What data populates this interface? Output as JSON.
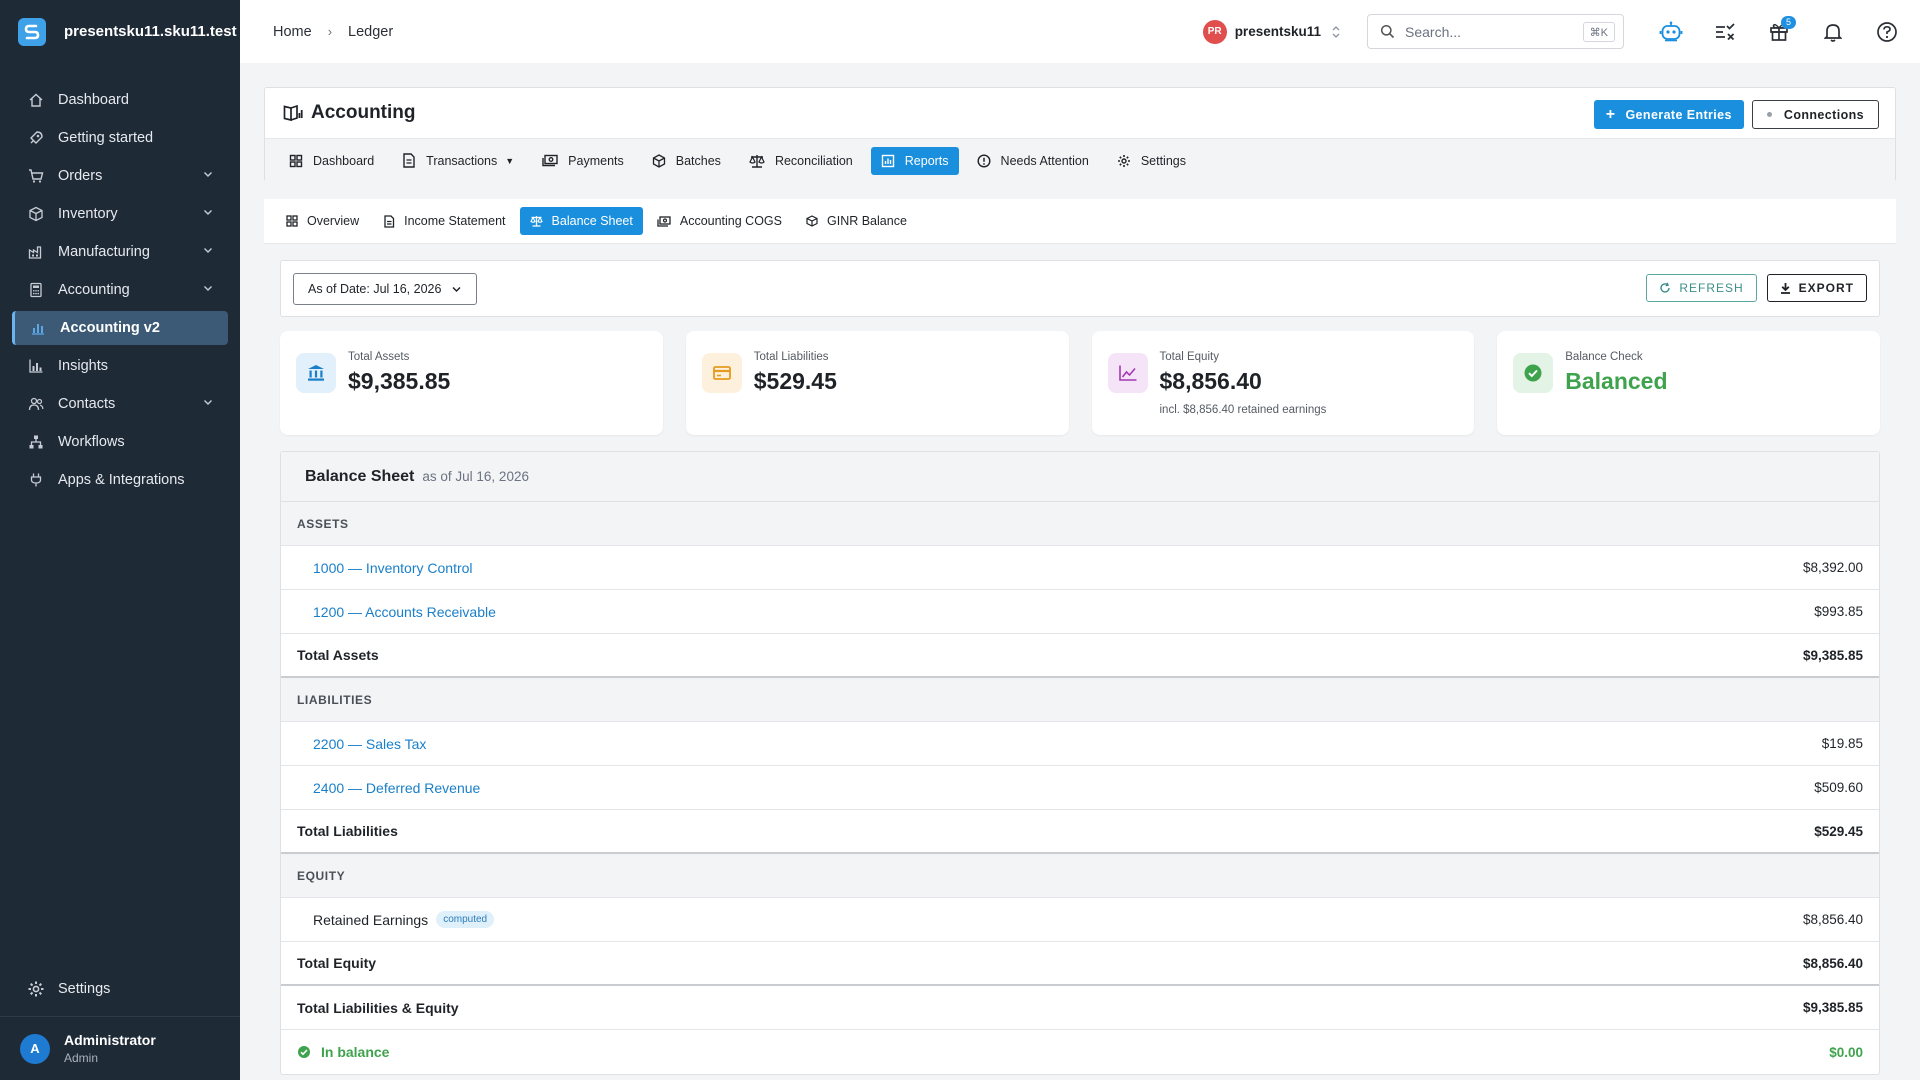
{
  "app": {
    "org_domain": "presentsku11.sku11.test",
    "brand_color": "#3fa2e9",
    "accent_color": "#1a8fde"
  },
  "sidebar": {
    "items": [
      {
        "label": "Dashboard",
        "icon": "home-icon",
        "expandable": false
      },
      {
        "label": "Getting started",
        "icon": "rocket-icon",
        "expandable": false
      },
      {
        "label": "Orders",
        "icon": "cart-icon",
        "expandable": true
      },
      {
        "label": "Inventory",
        "icon": "box-icon",
        "expandable": true
      },
      {
        "label": "Manufacturing",
        "icon": "factory-icon",
        "expandable": true
      },
      {
        "label": "Accounting",
        "icon": "calculator-icon",
        "expandable": true
      },
      {
        "label": "Accounting v2",
        "icon": "ledger-chart-icon",
        "expandable": false,
        "active": true
      },
      {
        "label": "Insights",
        "icon": "bar-chart-icon",
        "expandable": false
      },
      {
        "label": "Contacts",
        "icon": "people-icon",
        "expandable": true
      },
      {
        "label": "Workflows",
        "icon": "workflow-icon",
        "expandable": false
      },
      {
        "label": "Apps & Integrations",
        "icon": "plug-icon",
        "expandable": false
      }
    ],
    "settings_label": "Settings",
    "user": {
      "initial": "A",
      "name": "Administrator",
      "role": "Admin"
    }
  },
  "topbar": {
    "breadcrumb": [
      "Home",
      "Ledger"
    ],
    "org": {
      "initials": "PR",
      "name": "presentsku11"
    },
    "search": {
      "placeholder": "Search...",
      "shortcut": "⌘K"
    },
    "gift_count": "5"
  },
  "accounting": {
    "title": "Accounting",
    "generate_label": "Generate Entries",
    "connections_label": "Connections",
    "tabs": [
      {
        "label": "Dashboard",
        "icon": "grid-icon"
      },
      {
        "label": "Transactions",
        "icon": "document-icon",
        "dropdown": true
      },
      {
        "label": "Payments",
        "icon": "cash-icon"
      },
      {
        "label": "Batches",
        "icon": "cube-icon"
      },
      {
        "label": "Reconciliation",
        "icon": "scale-icon"
      },
      {
        "label": "Reports",
        "icon": "report-icon",
        "active": true
      },
      {
        "label": "Needs Attention",
        "icon": "alert-circle-icon"
      },
      {
        "label": "Settings",
        "icon": "gear-icon"
      }
    ]
  },
  "report_tabs": [
    {
      "label": "Overview",
      "icon": "grid-icon"
    },
    {
      "label": "Income Statement",
      "icon": "document-icon"
    },
    {
      "label": "Balance Sheet",
      "icon": "scale-icon",
      "active": true
    },
    {
      "label": "Accounting COGS",
      "icon": "cash-icon"
    },
    {
      "label": "GINR Balance",
      "icon": "cube-icon"
    }
  ],
  "toolbar": {
    "date_label": "As of Date:",
    "date_value": "Jul 16, 2026",
    "refresh_label": "REFRESH",
    "export_label": "EXPORT"
  },
  "kpis": [
    {
      "label": "Total Assets",
      "value": "$9,385.85",
      "icon": "bank-icon",
      "note": ""
    },
    {
      "label": "Total Liabilities",
      "value": "$529.45",
      "icon": "credit-card-icon",
      "note": ""
    },
    {
      "label": "Total Equity",
      "value": "$8,856.40",
      "icon": "trend-line-icon",
      "note": "incl. $8,856.40 retained earnings"
    },
    {
      "label": "Balance Check",
      "value": "Balanced",
      "icon": "check-circle-icon",
      "note": ""
    }
  ],
  "balance_sheet": {
    "title": "Balance Sheet",
    "subtitle": "as of Jul 16, 2026",
    "assets": {
      "header": "ASSETS",
      "lines": [
        {
          "label": "1000 — Inventory Control",
          "amount": "$8,392.00"
        },
        {
          "label": "1200 — Accounts Receivable",
          "amount": "$993.85"
        }
      ],
      "total_label": "Total Assets",
      "total": "$9,385.85"
    },
    "liabilities": {
      "header": "LIABILITIES",
      "lines": [
        {
          "label": "2200 — Sales Tax",
          "amount": "$19.85"
        },
        {
          "label": "2400 — Deferred Revenue",
          "amount": "$509.60"
        }
      ],
      "total_label": "Total Liabilities",
      "total": "$529.45"
    },
    "equity": {
      "header": "EQUITY",
      "retained_label": "Retained Earnings",
      "retained_chip": "computed",
      "retained_amount": "$8,856.40",
      "total_label": "Total Equity",
      "total": "$8,856.40"
    },
    "grand_total_label": "Total Liabilities & Equity",
    "grand_total": "$9,385.85",
    "balance_label": "In balance",
    "balance_amount": "$0.00"
  }
}
